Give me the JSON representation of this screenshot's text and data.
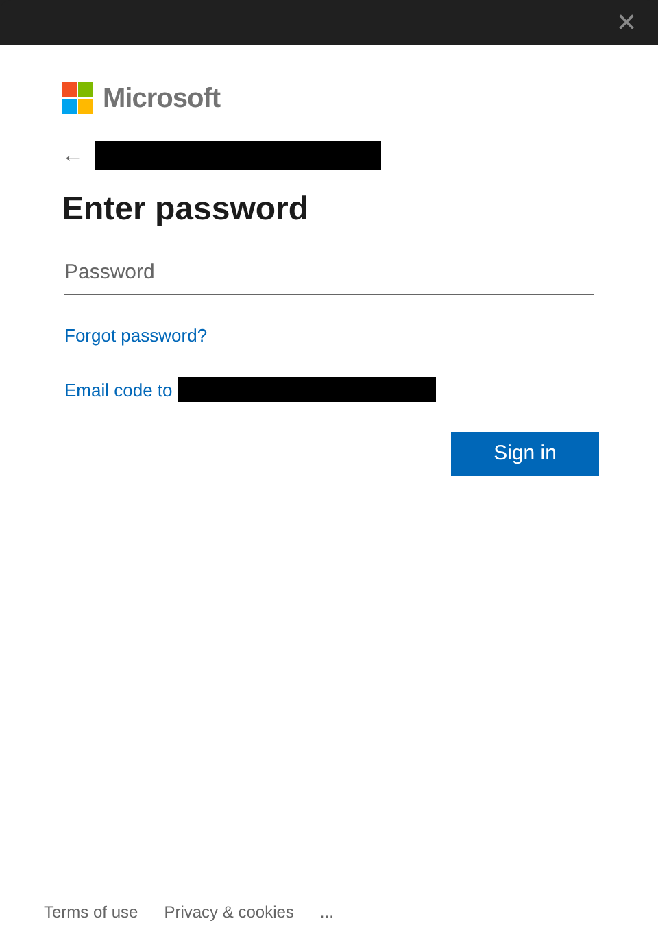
{
  "window": {
    "close": "×"
  },
  "brand": {
    "name": "Microsoft"
  },
  "account": {
    "back": "←",
    "redacted": true
  },
  "heading": "Enter password",
  "password": {
    "placeholder": "Password"
  },
  "links": [
    {
      "kind": "plain",
      "text": "Forgot password?"
    },
    {
      "kind": "redacted",
      "text": "Email code to"
    }
  ],
  "sign_in": "Sign in",
  "footer": [
    "Terms of use",
    "Privacy & cookies",
    "..."
  ]
}
